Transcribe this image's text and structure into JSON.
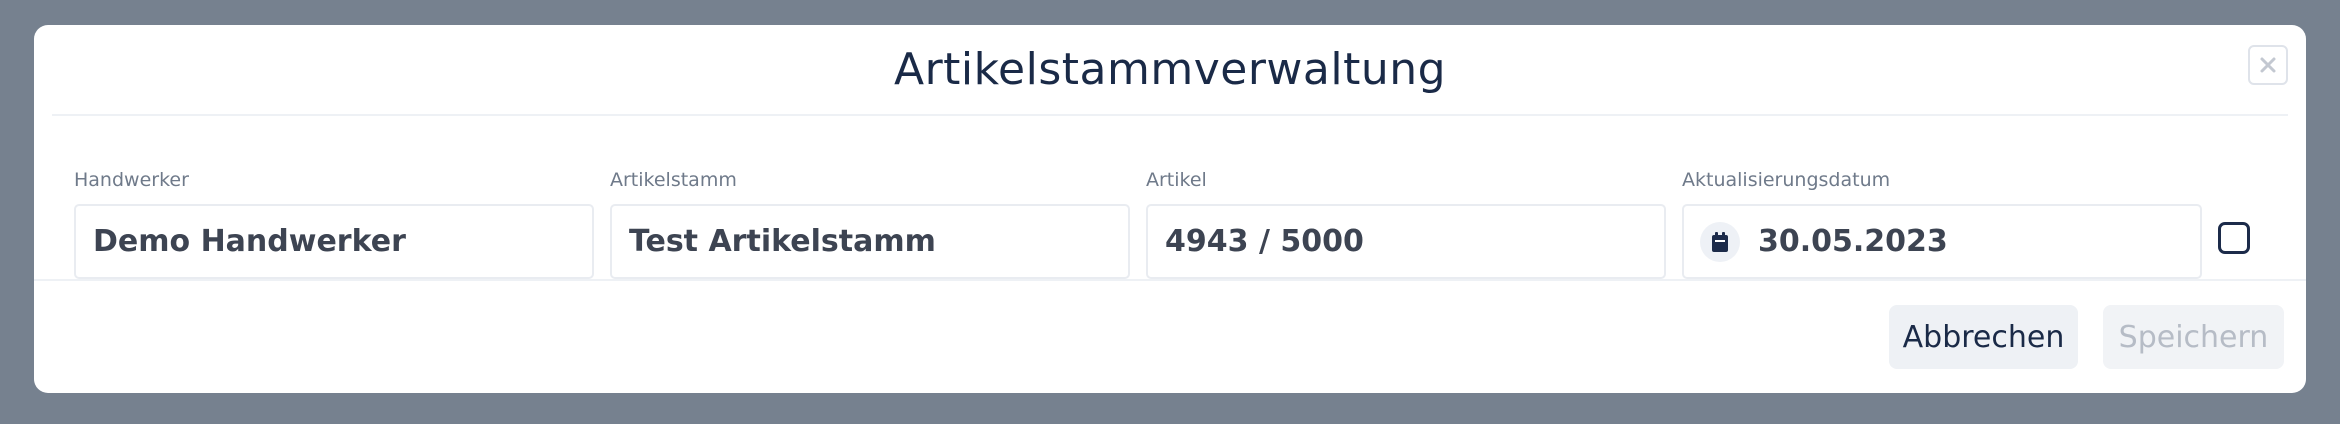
{
  "modal": {
    "title": "Artikelstammverwaltung",
    "close_icon": "close-icon"
  },
  "fields": [
    {
      "label": "Handwerker",
      "value": "Demo Handwerker"
    },
    {
      "label": "Artikelstamm",
      "value": "Test Artikelstamm"
    },
    {
      "label": "Artikel",
      "value": "4943 / 5000"
    },
    {
      "label": "Aktualisierungsdatum",
      "value": "30.05.2023",
      "icon": "calendar-icon"
    }
  ],
  "checkbox": {
    "checked": false
  },
  "footer": {
    "cancel_label": "Abbrechen",
    "save_label": "Speichern",
    "save_disabled": true
  },
  "colors": {
    "backdrop": "#76818f",
    "title": "#1a2a47",
    "label": "#6f7a8a",
    "value": "#3d4452",
    "disabled_text": "#b6bcc6"
  }
}
